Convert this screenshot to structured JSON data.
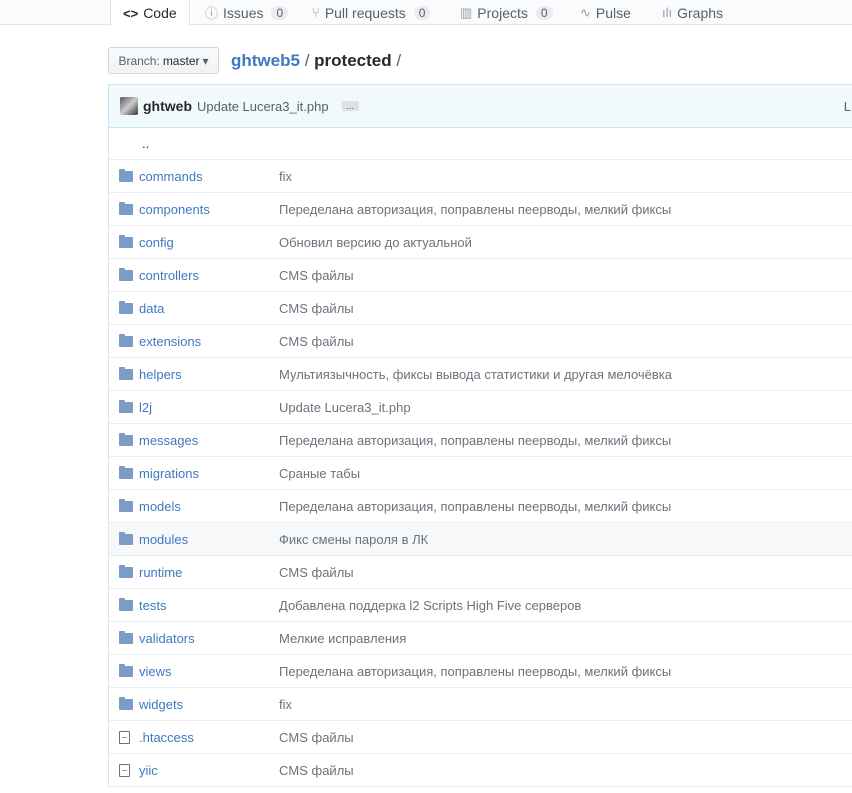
{
  "tabs": [
    {
      "label": "Code",
      "icon": "code-icon",
      "glyph": "<>",
      "selected": true
    },
    {
      "label": "Issues",
      "icon": "issue-opened-icon",
      "glyph": "ⓘ",
      "count": "0"
    },
    {
      "label": "Pull requests",
      "icon": "git-pull-request-icon",
      "glyph": "⑂",
      "count": "0"
    },
    {
      "label": "Projects",
      "icon": "project-icon",
      "glyph": "▥",
      "count": "0"
    },
    {
      "label": "Pulse",
      "icon": "pulse-icon",
      "glyph": "∿"
    },
    {
      "label": "Graphs",
      "icon": "graph-icon",
      "glyph": "ılı"
    }
  ],
  "branch": {
    "prefix": "Branch:",
    "name": "master",
    "caret": "▾"
  },
  "breadcrumb": {
    "repo": "ghtweb5",
    "sep": "/",
    "folder": "protected",
    "trail": "/"
  },
  "commit": {
    "author": "ghtweb",
    "message": "Update Lucera3_it.php",
    "ellipsis": "…",
    "truncated": "L"
  },
  "up": "..",
  "files": [
    {
      "name": "commands",
      "type": "dir",
      "message": "fix"
    },
    {
      "name": "components",
      "type": "dir",
      "message": "Переделана авторизация, поправлены пеерводы, мелкий фиксы"
    },
    {
      "name": "config",
      "type": "dir",
      "message": "Обновил версию до актуальной"
    },
    {
      "name": "controllers",
      "type": "dir",
      "message": "CMS файлы"
    },
    {
      "name": "data",
      "type": "dir",
      "message": "CMS файлы"
    },
    {
      "name": "extensions",
      "type": "dir",
      "message": "CMS файлы"
    },
    {
      "name": "helpers",
      "type": "dir",
      "message": "Мультиязычность, фиксы вывода статистики и другая мелочёвка"
    },
    {
      "name": "l2j",
      "type": "dir",
      "message": "Update Lucera3_it.php"
    },
    {
      "name": "messages",
      "type": "dir",
      "message": "Переделана авторизация, поправлены пеерводы, мелкий фиксы"
    },
    {
      "name": "migrations",
      "type": "dir",
      "message": "Сраные табы"
    },
    {
      "name": "models",
      "type": "dir",
      "message": "Переделана авторизация, поправлены пеерводы, мелкий фиксы"
    },
    {
      "name": "modules",
      "type": "dir",
      "message": "Фикс смены пароля в ЛК",
      "hovered": true
    },
    {
      "name": "runtime",
      "type": "dir",
      "message": "CMS файлы"
    },
    {
      "name": "tests",
      "type": "dir",
      "message": "Добавлена поддерка l2 Scripts High Five серверов"
    },
    {
      "name": "validators",
      "type": "dir",
      "message": "Мелкие исправления"
    },
    {
      "name": "views",
      "type": "dir",
      "message": "Переделана авторизация, поправлены пеерводы, мелкий фиксы"
    },
    {
      "name": "widgets",
      "type": "dir",
      "message": "fix"
    },
    {
      "name": ".htaccess",
      "type": "file",
      "message": "CMS файлы"
    },
    {
      "name": "yiic",
      "type": "file",
      "message": "CMS файлы"
    }
  ]
}
